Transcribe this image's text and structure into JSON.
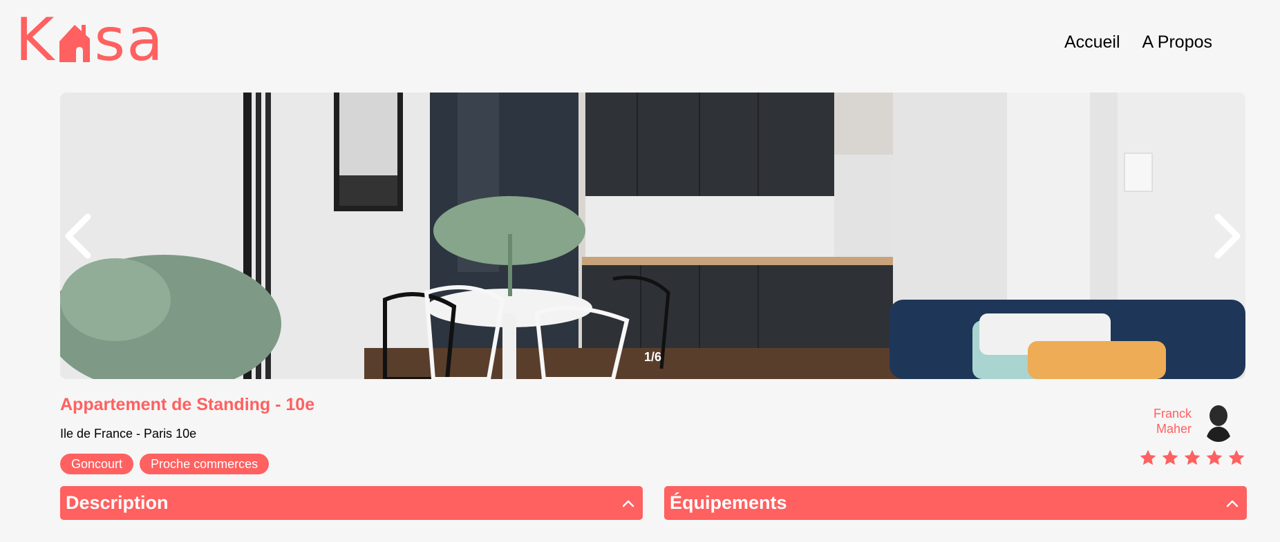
{
  "brand": {
    "logo_text": "Kasa",
    "color": "#ff6060"
  },
  "nav": {
    "items": [
      "Accueil",
      "A Propos"
    ]
  },
  "carousel": {
    "counter": "1/6",
    "prev_icon": "chevron-left-icon",
    "next_icon": "chevron-right-icon"
  },
  "listing": {
    "title": "Appartement de Standing - 10e",
    "location": "Ile de France - Paris 10e",
    "tags": [
      "Goncourt",
      "Proche commerces"
    ]
  },
  "host": {
    "first_name": "Franck",
    "last_name": "Maher",
    "rating": 5,
    "rating_max": 5
  },
  "collapses": [
    {
      "title": "Description"
    },
    {
      "title": "Équipements"
    }
  ]
}
